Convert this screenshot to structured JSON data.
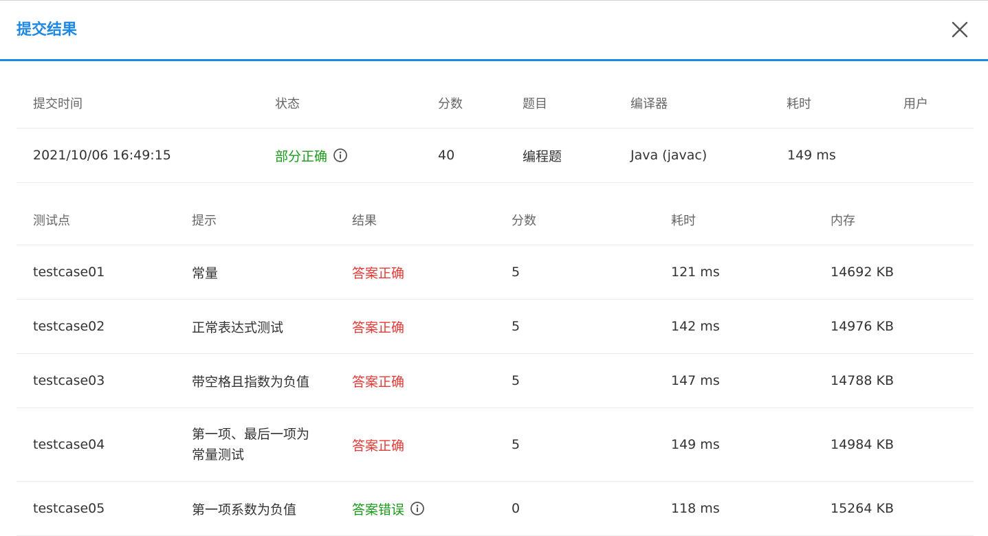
{
  "dialog": {
    "title": "提交结果",
    "close_icon": "close-icon"
  },
  "summary": {
    "headers": [
      "提交时间",
      "状态",
      "分数",
      "题目",
      "编译器",
      "耗时",
      "用户"
    ],
    "row": {
      "time": "2021/10/06 16:49:15",
      "status": "部分正确",
      "score": "40",
      "problem": "编程题",
      "compiler": "Java (javac)",
      "elapsed": "149 ms",
      "user": ""
    }
  },
  "testcases": {
    "headers": [
      "测试点",
      "提示",
      "结果",
      "分数",
      "耗时",
      "内存"
    ],
    "rows": [
      {
        "id": "testcase01",
        "hint": "常量",
        "result": "答案正确",
        "score": "5",
        "time": "121 ms",
        "memory": "14692 KB"
      },
      {
        "id": "testcase02",
        "hint": "正常表达式测试",
        "result": "答案正确",
        "score": "5",
        "time": "142 ms",
        "memory": "14976 KB"
      },
      {
        "id": "testcase03",
        "hint": "带空格且指数为负值",
        "result": "答案正确",
        "score": "5",
        "time": "147 ms",
        "memory": "14788 KB"
      },
      {
        "id": "testcase04",
        "hint_line1": "第一项、最后一项为",
        "hint_line2": "常量测试",
        "result": "答案正确",
        "score": "5",
        "time": "149 ms",
        "memory": "14984 KB"
      },
      {
        "id": "testcase05",
        "hint": "第一项系数为负值",
        "result": "答案错误",
        "score": "0",
        "time": "118 ms",
        "memory": "15264 KB"
      }
    ]
  },
  "colors": {
    "accent": "#1e88e5",
    "partial_or_wrong": "#1a9b1a",
    "correct": "#e53935"
  }
}
